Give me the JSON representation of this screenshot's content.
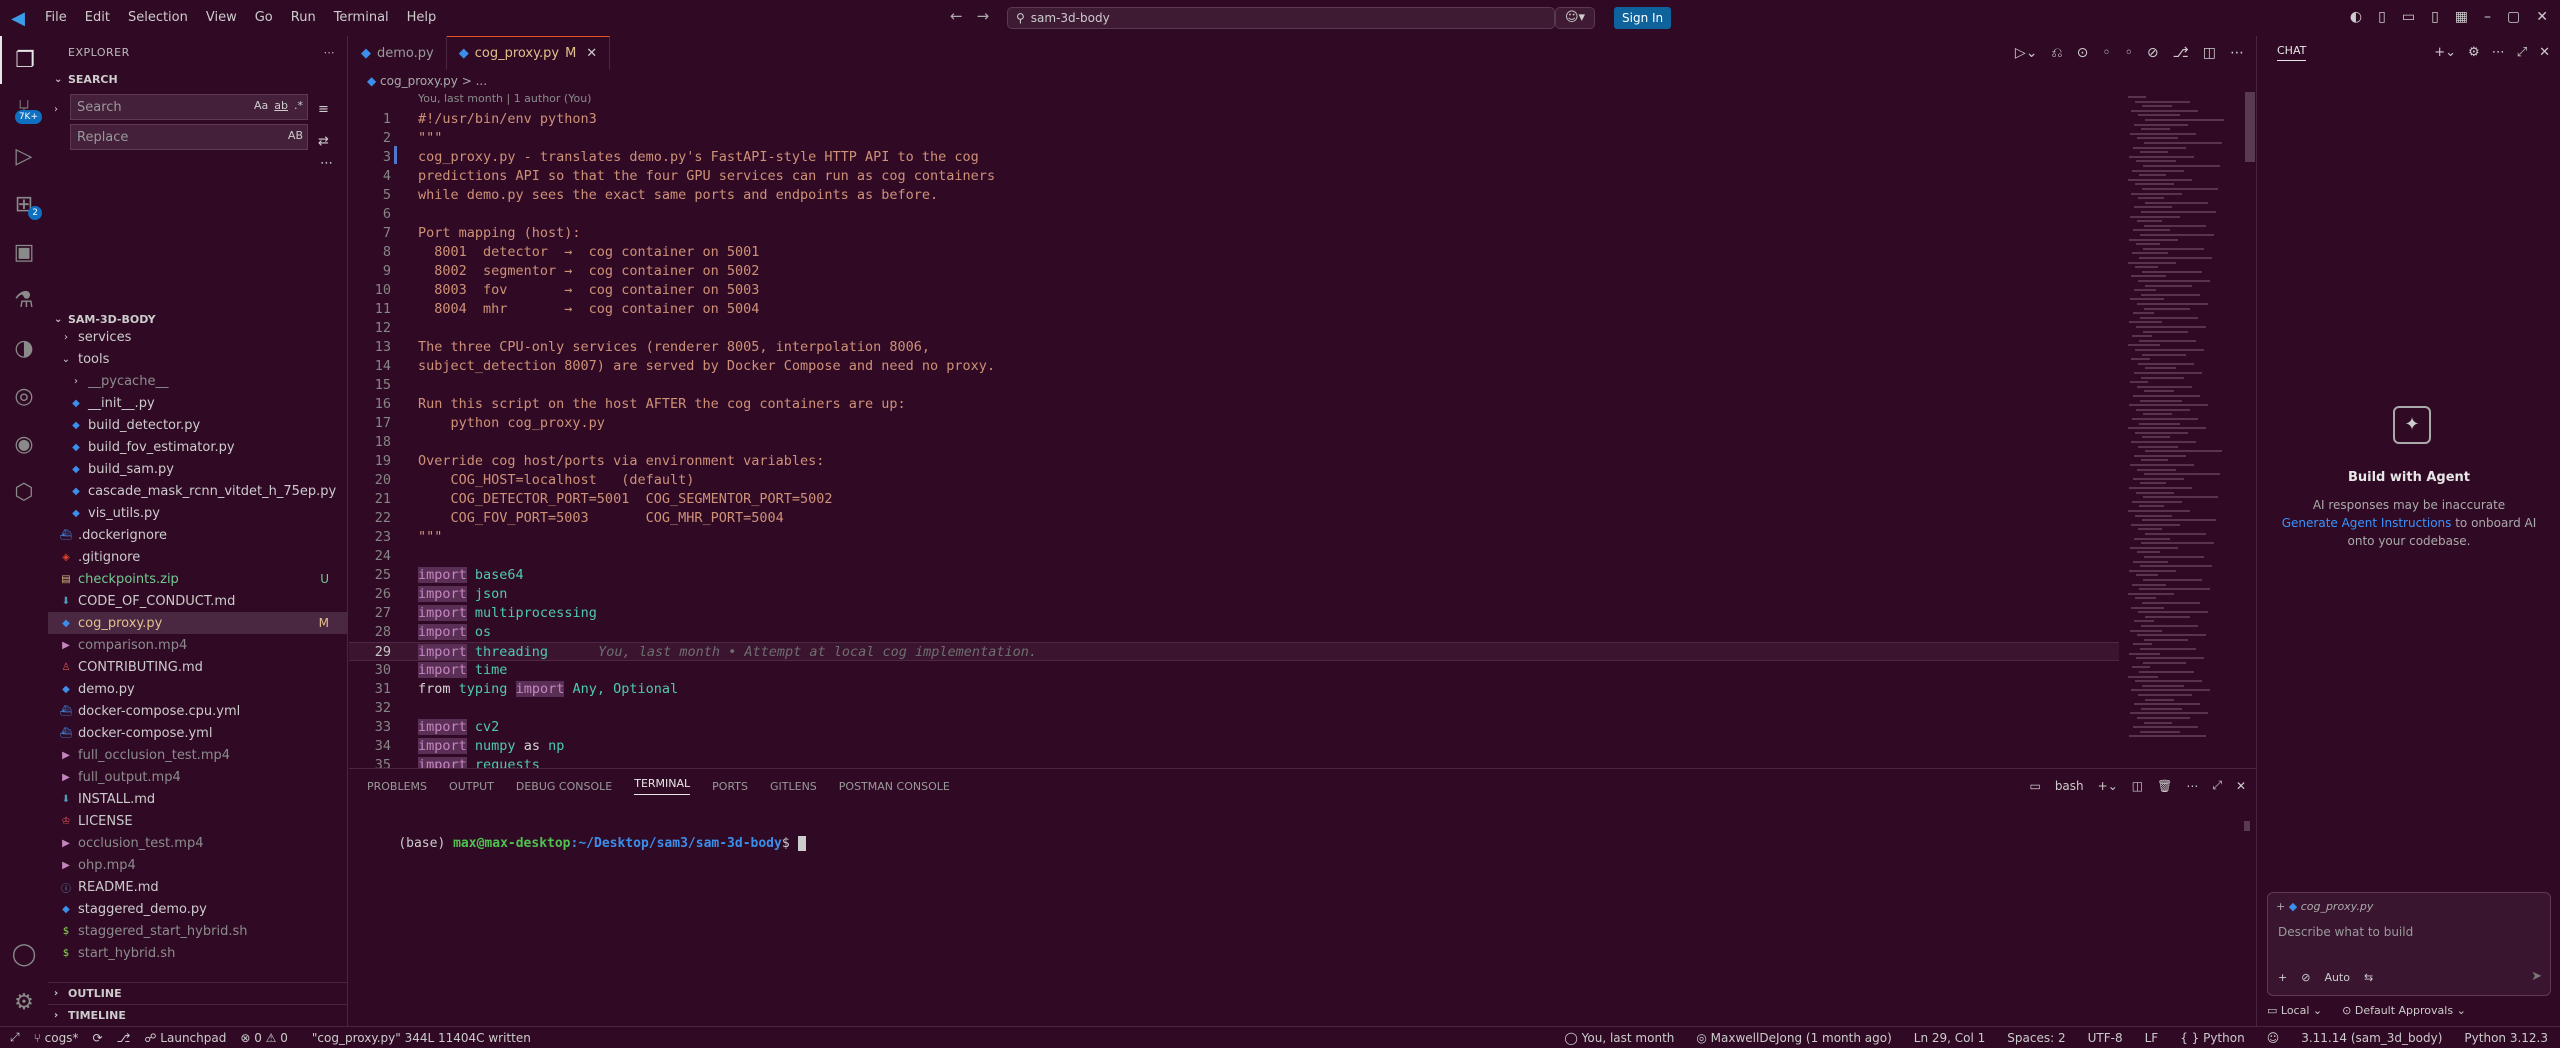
{
  "menu": [
    "File",
    "Edit",
    "Selection",
    "View",
    "Go",
    "Run",
    "Terminal",
    "Help"
  ],
  "command_center": "sam-3d-body",
  "sign_in": "Sign In",
  "activity_badges": {
    "accounts": "7K+",
    "extensions": "2"
  },
  "sidebar": {
    "explorer_title": "EXPLORER",
    "search_section": "SEARCH",
    "search_placeholder": "Search",
    "search_opts": [
      "Aa",
      "ab",
      ".*"
    ],
    "replace_placeholder": "Replace",
    "replace_opt": "AB",
    "project": "SAM-3D-BODY",
    "files": [
      {
        "name": "services",
        "type": "folder-closed",
        "depth": 1,
        "cls": ""
      },
      {
        "name": "tools",
        "type": "folder-open",
        "depth": 1,
        "cls": ""
      },
      {
        "name": "__pycache__",
        "type": "folder-closed",
        "depth": 2,
        "cls": "gray"
      },
      {
        "name": "__init__.py",
        "type": "py",
        "depth": 2,
        "cls": ""
      },
      {
        "name": "build_detector.py",
        "type": "py",
        "depth": 2,
        "cls": ""
      },
      {
        "name": "build_fov_estimator.py",
        "type": "py",
        "depth": 2,
        "cls": ""
      },
      {
        "name": "build_sam.py",
        "type": "py",
        "depth": 2,
        "cls": ""
      },
      {
        "name": "cascade_mask_rcnn_vitdet_h_75ep.py",
        "type": "py",
        "depth": 2,
        "cls": ""
      },
      {
        "name": "vis_utils.py",
        "type": "py",
        "depth": 2,
        "cls": ""
      },
      {
        "name": ".dockerignore",
        "type": "docker",
        "depth": 1,
        "cls": ""
      },
      {
        "name": ".gitignore",
        "type": "git",
        "depth": 1,
        "cls": ""
      },
      {
        "name": "checkpoints.zip",
        "type": "zip",
        "depth": 1,
        "cls": "green",
        "badge": "U"
      },
      {
        "name": "CODE_OF_CONDUCT.md",
        "type": "md",
        "depth": 1,
        "cls": ""
      },
      {
        "name": "cog_proxy.py",
        "type": "py",
        "depth": 1,
        "cls": "yellowish",
        "badge": "M",
        "selected": true
      },
      {
        "name": "comparison.mp4",
        "type": "media",
        "depth": 1,
        "cls": "gray"
      },
      {
        "name": "CONTRIBUTING.md",
        "type": "md-red",
        "depth": 1,
        "cls": ""
      },
      {
        "name": "demo.py",
        "type": "py",
        "depth": 1,
        "cls": ""
      },
      {
        "name": "docker-compose.cpu.yml",
        "type": "docker",
        "depth": 1,
        "cls": ""
      },
      {
        "name": "docker-compose.yml",
        "type": "docker",
        "depth": 1,
        "cls": ""
      },
      {
        "name": "full_occlusion_test.mp4",
        "type": "media",
        "depth": 1,
        "cls": "gray"
      },
      {
        "name": "full_output.mp4",
        "type": "media",
        "depth": 1,
        "cls": "gray"
      },
      {
        "name": "INSTALL.md",
        "type": "md",
        "depth": 1,
        "cls": ""
      },
      {
        "name": "LICENSE",
        "type": "license",
        "depth": 1,
        "cls": ""
      },
      {
        "name": "occlusion_test.mp4",
        "type": "media",
        "depth": 1,
        "cls": "gray"
      },
      {
        "name": "ohp.mp4",
        "type": "media",
        "depth": 1,
        "cls": "gray"
      },
      {
        "name": "README.md",
        "type": "info",
        "depth": 1,
        "cls": ""
      },
      {
        "name": "staggered_demo.py",
        "type": "py",
        "depth": 1,
        "cls": ""
      },
      {
        "name": "staggered_start_hybrid.sh",
        "type": "sh",
        "depth": 1,
        "cls": "gray"
      },
      {
        "name": "start_hybrid.sh",
        "type": "sh",
        "depth": 1,
        "cls": "gray"
      }
    ],
    "outline": "OUTLINE",
    "timeline": "TIMELINE"
  },
  "tabs": [
    {
      "label": "demo.py",
      "active": false
    },
    {
      "label": "cog_proxy.py",
      "active": true,
      "mod": "M"
    }
  ],
  "breadcrumb": "cog_proxy.py > ...",
  "blame_header": "You, last month | 1 author (You)",
  "inline_blame": "You, last month • Attempt at local cog implementation.",
  "current_line": 29,
  "code": [
    [
      [
        "#!/usr/bin/env python3",
        "c-str"
      ]
    ],
    [
      [
        "\"\"\"",
        "c-str"
      ]
    ],
    [
      [
        "cog_proxy.py - translates demo.py's FastAPI-style HTTP API to the cog",
        "c-str"
      ]
    ],
    [
      [
        "predictions API so that the four GPU services can run as cog containers",
        "c-str"
      ]
    ],
    [
      [
        "while demo.py sees the exact same ports and endpoints as before.",
        "c-str"
      ]
    ],
    [
      [
        "",
        "c-str"
      ]
    ],
    [
      [
        "Port mapping (host):",
        "c-str"
      ]
    ],
    [
      [
        "  8001  detector  →  cog container on 5001",
        "c-str"
      ]
    ],
    [
      [
        "  8002  segmentor →  cog container on 5002",
        "c-str"
      ]
    ],
    [
      [
        "  8003  fov       →  cog container on 5003",
        "c-str"
      ]
    ],
    [
      [
        "  8004  mhr       →  cog container on 5004",
        "c-str"
      ]
    ],
    [
      [
        "",
        "c-str"
      ]
    ],
    [
      [
        "The three CPU-only services (renderer 8005, interpolation 8006,",
        "c-str"
      ]
    ],
    [
      [
        "subject_detection 8007) are served by Docker Compose and need no proxy.",
        "c-str"
      ]
    ],
    [
      [
        "",
        "c-str"
      ]
    ],
    [
      [
        "Run this script on the host AFTER the cog containers are up:",
        "c-str"
      ]
    ],
    [
      [
        "    python cog_proxy.py",
        "c-str"
      ]
    ],
    [
      [
        "",
        "c-str"
      ]
    ],
    [
      [
        "Override cog host/ports via environment variables:",
        "c-str"
      ]
    ],
    [
      [
        "    COG_HOST=localhost   (default)",
        "c-str"
      ]
    ],
    [
      [
        "    COG_DETECTOR_PORT=5001  COG_SEGMENTOR_PORT=5002",
        "c-str"
      ]
    ],
    [
      [
        "    COG_FOV_PORT=5003       COG_MHR_PORT=5004",
        "c-str"
      ]
    ],
    [
      [
        "\"\"\"",
        "c-str"
      ]
    ],
    [
      [
        "",
        "c-id"
      ]
    ],
    [
      [
        "import",
        "c-kw"
      ],
      [
        " base64",
        "c-mod"
      ]
    ],
    [
      [
        "import",
        "c-kw"
      ],
      [
        " json",
        "c-mod"
      ]
    ],
    [
      [
        "import",
        "c-kw"
      ],
      [
        " multiprocessing",
        "c-mod"
      ]
    ],
    [
      [
        "import",
        "c-kw"
      ],
      [
        " os",
        "c-mod"
      ]
    ],
    [
      [
        "import",
        "c-kw"
      ],
      [
        " threading",
        "c-mod"
      ]
    ],
    [
      [
        "import",
        "c-kw"
      ],
      [
        " time",
        "c-mod"
      ]
    ],
    [
      [
        "from ",
        "c-id"
      ],
      [
        "typing",
        "c-mod"
      ],
      [
        " ",
        "c-id"
      ],
      [
        "import",
        "c-kw"
      ],
      [
        " Any, Optional",
        "c-cls"
      ]
    ],
    [
      [
        "",
        "c-id"
      ]
    ],
    [
      [
        "import",
        "c-kw"
      ],
      [
        " cv2",
        "c-mod"
      ]
    ],
    [
      [
        "import",
        "c-kw"
      ],
      [
        " numpy",
        "c-mod"
      ],
      [
        " as ",
        "c-id"
      ],
      [
        "np",
        "c-mod"
      ]
    ],
    [
      [
        "import",
        "c-kw"
      ],
      [
        " requests",
        "c-mod"
      ]
    ]
  ],
  "panel": {
    "tabs": [
      "PROBLEMS",
      "OUTPUT",
      "DEBUG CONSOLE",
      "TERMINAL",
      "PORTS",
      "GITLENS",
      "POSTMAN CONSOLE"
    ],
    "active": "TERMINAL",
    "shell": "bash",
    "prompt_env": "(base) ",
    "prompt_user": "max@max-desktop",
    "prompt_path": ":~/Desktop/sam3/sam-3d-body",
    "prompt_end": "$ "
  },
  "chat": {
    "title": "CHAT",
    "agent_title": "Build with Agent",
    "note_1": "AI responses may be inaccurate",
    "note_link": "Generate Agent Instructions",
    "note_2": " to onboard AI onto your codebase.",
    "context_file": "cog_proxy.py",
    "placeholder": "Describe what to build",
    "mode": "Auto",
    "local": "Local",
    "approvals": "Default Approvals"
  },
  "status": {
    "branch": "cogs*",
    "launchpad": "Launchpad",
    "problems": "⊗ 0  ⚠ 0",
    "message": "\"cog_proxy.py\" 344L 11404C written",
    "blame": "You, last month",
    "author": "MaxwellDeJong (1 month ago)",
    "position": "Ln 29, Col 1",
    "spaces": "Spaces: 2",
    "encoding": "UTF-8",
    "eol": "LF",
    "language": "{ } Python",
    "env": "3.11.14 (sam_3d_body)",
    "python": "Python 3.12.3"
  }
}
